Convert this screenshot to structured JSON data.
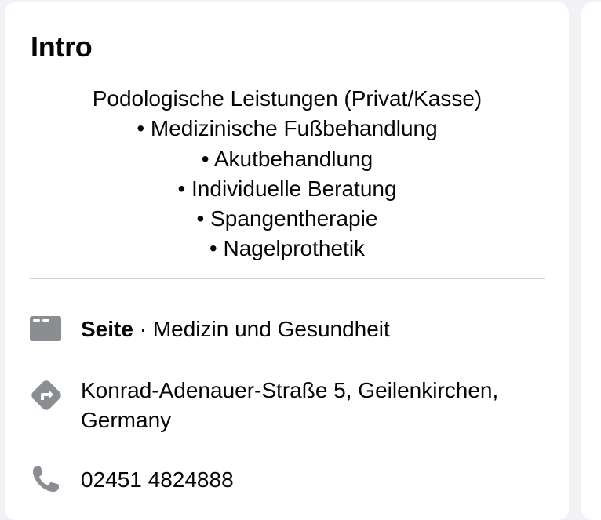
{
  "intro": {
    "title": "Intro",
    "bio_lines": [
      "Podologische Leistungen (Privat/Kasse)",
      "• Medizinische Fußbehandlung",
      "• Akutbehandlung",
      "• Individuelle Beratung",
      "• Spangentherapie",
      "• Nagelprothetik"
    ]
  },
  "details": {
    "page": {
      "icon": "flag-page-icon",
      "label": "Seite",
      "separator": " · ",
      "category": "Medizin und Gesundheit"
    },
    "address": {
      "icon": "directions-icon",
      "line1": "Konrad-Adenauer-Straße 5, Geilenkirchen,",
      "line2": "Germany"
    },
    "phone": {
      "icon": "phone-icon",
      "number": "02451 4824888"
    }
  },
  "colors": {
    "icon_gray": "#8a8d91",
    "divider": "#ced0d4",
    "text": "#050505",
    "background": "#f0f2f5"
  }
}
